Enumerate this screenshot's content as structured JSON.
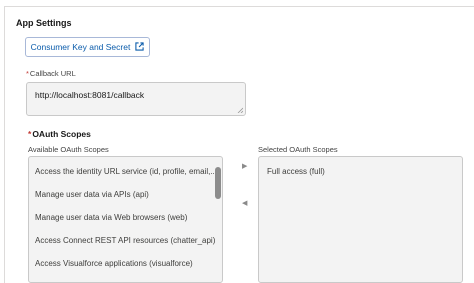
{
  "section": {
    "title": "App Settings"
  },
  "consumer_button": {
    "label": "Consumer Key and Secret",
    "icon": "external-link-icon"
  },
  "callback": {
    "required_mark": "*",
    "label": "Callback URL",
    "value": "http://localhost:8081/callback"
  },
  "oauth": {
    "required_mark": "*",
    "title": "OAuth Scopes",
    "available_label": "Available OAuth Scopes",
    "selected_label": "Selected OAuth Scopes",
    "available": [
      "Access the identity URL service (id, profile, email,...",
      "Manage user data via APIs (api)",
      "Manage user data via Web browsers (web)",
      "Access Connect REST API resources (chatter_api)",
      "Access Visualforce applications (visualforce)"
    ],
    "selected": [
      "Full access (full)"
    ],
    "add_arrow": "▶",
    "remove_arrow": "◀"
  },
  "colors": {
    "accent": "#0b5cab",
    "required": "#c23934",
    "field_bg": "#f3f3f3"
  }
}
